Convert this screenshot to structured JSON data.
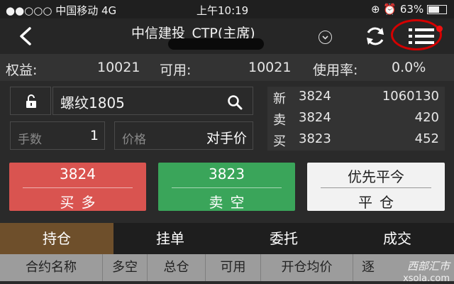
{
  "status_bar": {
    "carrier": "●●○○○ 中国移动   4G",
    "time": "上午10:19",
    "battery": "63%"
  },
  "header": {
    "title": "中信建投_CTP(主席)"
  },
  "account": {
    "equity_label": "权益:",
    "equity_value": "10021",
    "available_label": "可用:",
    "available_value": "10021",
    "usage_label": "使用率:",
    "usage_value": "0.0%"
  },
  "order": {
    "symbol": "螺纹1805",
    "qty_label": "手数",
    "qty_value": "1",
    "price_label": "价格",
    "price_value": "对手价"
  },
  "quotes": [
    {
      "key": "新",
      "price": "3824",
      "value": "1060130"
    },
    {
      "key": "卖",
      "price": "3824",
      "value": "420"
    },
    {
      "key": "买",
      "price": "3823",
      "value": "452"
    }
  ],
  "actions": {
    "buy": {
      "price": "3824",
      "label": "买多"
    },
    "sell": {
      "price": "3823",
      "label": "卖空"
    },
    "close": {
      "price": "优先平今",
      "label": "平仓"
    }
  },
  "tabs": [
    {
      "label": "持仓"
    },
    {
      "label": "挂单"
    },
    {
      "label": "委托"
    },
    {
      "label": "成交"
    }
  ],
  "table_headers": [
    "合约名称",
    "多空",
    "总仓",
    "可用",
    "开仓均价",
    "逐"
  ],
  "watermark": {
    "line1": "西部汇市",
    "line2": "xsola.com"
  },
  "colors": {
    "buy": "#d95450",
    "sell": "#3aa55a",
    "close": "#f2f2f2",
    "active_tab": "#6e4f2b",
    "highlight_circle": "#d40000"
  }
}
